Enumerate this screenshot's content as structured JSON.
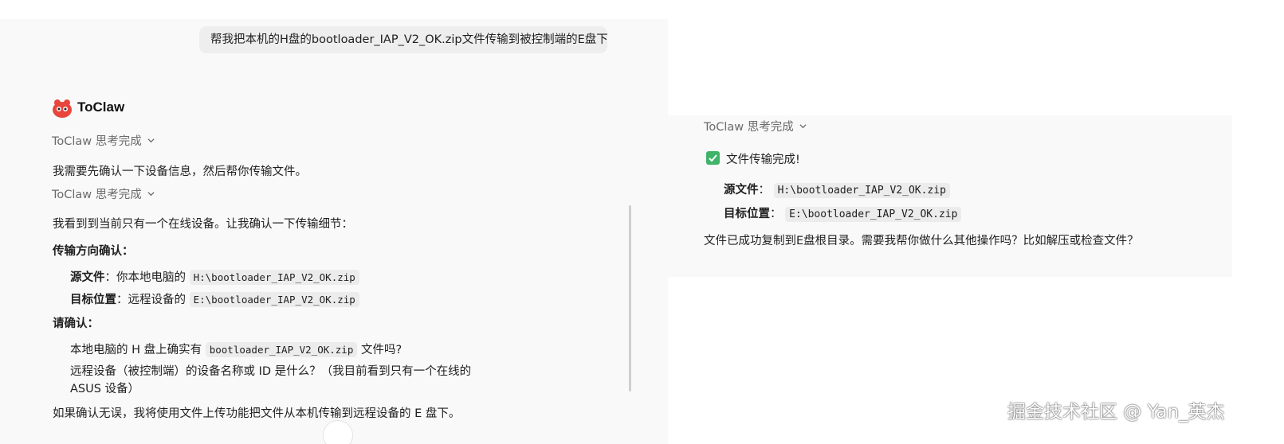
{
  "user_message": "帮我把本机的H盘的bootloader_IAP_V2_OK.zip文件传输到被控制端的E盘下",
  "assistant": {
    "name": "ToClaw",
    "thinking_label": "ToClaw 思考完成",
    "msg1": "我需要先确认一下设备信息，然后帮你传输文件。",
    "msg2": "我看到到当前只有一个在线设备。让我确认一下传输细节：",
    "section1_title": "传输方向确认：",
    "source_label": "源文件",
    "source_prefix": "：你本地电脑的",
    "source_path": "H:\\bootloader_IAP_V2_OK.zip",
    "target_label": "目标位置",
    "target_prefix": "：远程设备的",
    "target_path": "E:\\bootloader_IAP_V2_OK.zip",
    "section2_title": "请确认：",
    "confirm1_prefix": "本地电脑的 H 盘上确实有",
    "confirm1_code": "bootloader_IAP_V2_OK.zip",
    "confirm1_suffix": "文件吗?",
    "confirm2_line1": "远程设备（被控制端）的设备名称或 ID 是什么？（我目前看到只有一个在线的",
    "confirm2_line2": "ASUS 设备）",
    "final_msg": "如果确认无误，我将使用文件上传功能把文件从本机传输到远程设备的 E 盘下。"
  },
  "result": {
    "thinking_label": "ToClaw 思考完成",
    "done_title": "文件传输完成!",
    "source_label": "源文件",
    "source_sep": "：",
    "source_path": "H:\\bootloader_IAP_V2_OK.zip",
    "target_label": "目标位置",
    "target_sep": "：",
    "target_path": "E:\\bootloader_IAP_V2_OK.zip",
    "summary": "文件已成功复制到E盘根目录。需要我帮你做什么其他操作吗？比如解压或检查文件？"
  },
  "watermark": "掘金技术社区 @ Yan_英杰",
  "icons": {
    "logo": "toclaw-logo-icon",
    "chevron": "chevron-down-icon",
    "check": "check-box-icon",
    "scroll": "scroll-down-icon"
  },
  "colors": {
    "panel_bg": "#f9f9f9",
    "bubble_bg": "#eeeeee",
    "code_bg": "#ececec",
    "check_green": "#3fb468",
    "logo_red": "#e8453c"
  }
}
